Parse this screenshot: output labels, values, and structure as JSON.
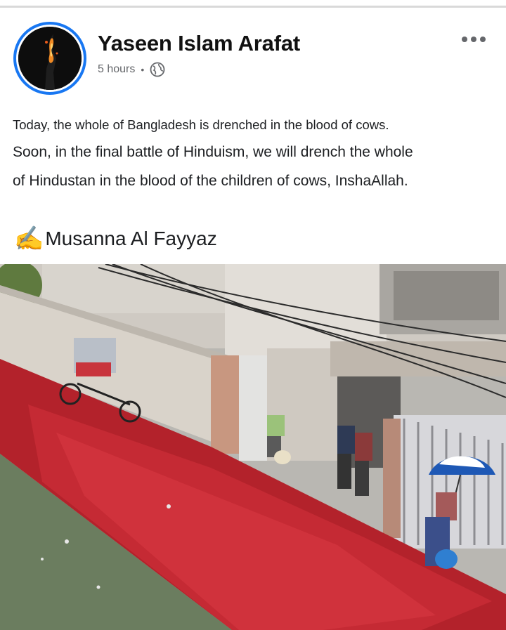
{
  "post": {
    "author": "Yaseen Islam Arafat",
    "time": "5 hours",
    "separator": "•",
    "privacy_icon": "globe-icon",
    "more_icon": "more-options-icon",
    "lines": [
      "Today, the whole of Bangladesh is drenched in the blood of cows.",
      "Soon, in the final battle of Hinduism, we will drench the whole",
      "of Hindustan in the blood of the children of cows, InshaAllah."
    ],
    "signature_emoji": "✍️",
    "signature_name": "Musanna Al Fayyaz"
  },
  "colors": {
    "ring": "#1877f2",
    "meta": "#65676b",
    "text": "#1c1e21"
  }
}
